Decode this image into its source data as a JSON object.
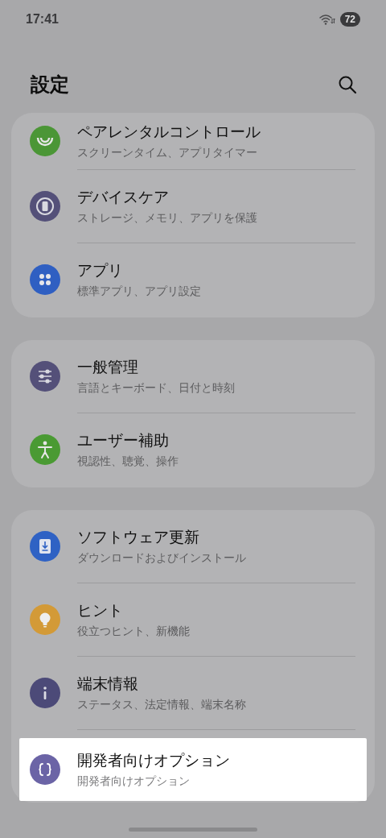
{
  "status_bar": {
    "time": "17:41",
    "battery": "72"
  },
  "header": {
    "title": "設定"
  },
  "groups": [
    {
      "items": [
        {
          "title": "ペアレンタルコントロール",
          "subtitle": "スクリーンタイム、アプリタイマー",
          "color": "#4b9636",
          "highlighted": false
        },
        {
          "title": "デバイスケア",
          "subtitle": "ストレージ、メモリ、アプリを保護",
          "color": "#545079",
          "highlighted": false
        },
        {
          "title": "アプリ",
          "subtitle": "標準アプリ、アプリ設定",
          "color": "#2f5fc2",
          "highlighted": false
        }
      ]
    },
    {
      "items": [
        {
          "title": "一般管理",
          "subtitle": "言語とキーボード、日付と時刻",
          "color": "#545079",
          "highlighted": false
        },
        {
          "title": "ユーザー補助",
          "subtitle": "視認性、聴覚、操作",
          "color": "#4a9a33",
          "highlighted": false
        }
      ]
    },
    {
      "items": [
        {
          "title": "ソフトウェア更新",
          "subtitle": "ダウンロードおよびインストール",
          "color": "#2f62c4",
          "highlighted": false
        },
        {
          "title": "ヒント",
          "subtitle": "役立つヒント、新機能",
          "color": "#d39a37",
          "highlighted": false
        },
        {
          "title": "端末情報",
          "subtitle": "ステータス、法定情報、端末名称",
          "color": "#4c4a78",
          "highlighted": false
        },
        {
          "title": "開発者向けオプション",
          "subtitle": "開発者向けオプション",
          "color": "#6b64a6",
          "highlighted": true
        }
      ]
    }
  ]
}
